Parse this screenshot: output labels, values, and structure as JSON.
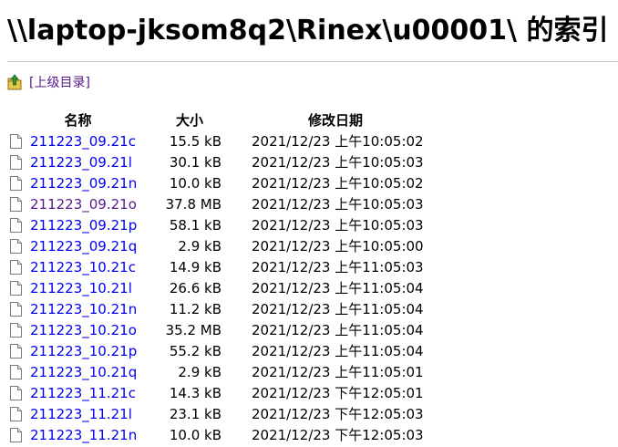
{
  "page": {
    "title": "\\\\laptop-jksom8q2\\Rinex\\u00001\\ 的索引"
  },
  "parent_link": {
    "label": "[上级目录]",
    "icon": "folder-up-icon"
  },
  "columns": {
    "name": "名称",
    "size": "大小",
    "modified": "修改日期"
  },
  "files": [
    {
      "name": "211223_09.21c",
      "size": "15.5 kB",
      "modified": "2021/12/23 上午10:05:02",
      "visited": false
    },
    {
      "name": "211223_09.21l",
      "size": "30.1 kB",
      "modified": "2021/12/23 上午10:05:03",
      "visited": false
    },
    {
      "name": "211223_09.21n",
      "size": "10.0 kB",
      "modified": "2021/12/23 上午10:05:02",
      "visited": false
    },
    {
      "name": "211223_09.21o",
      "size": "37.8 MB",
      "modified": "2021/12/23 上午10:05:03",
      "visited": true
    },
    {
      "name": "211223_09.21p",
      "size": "58.1 kB",
      "modified": "2021/12/23 上午10:05:03",
      "visited": false
    },
    {
      "name": "211223_09.21q",
      "size": "2.9 kB",
      "modified": "2021/12/23 上午10:05:00",
      "visited": false
    },
    {
      "name": "211223_10.21c",
      "size": "14.9 kB",
      "modified": "2021/12/23 上午11:05:03",
      "visited": false
    },
    {
      "name": "211223_10.21l",
      "size": "26.6 kB",
      "modified": "2021/12/23 上午11:05:04",
      "visited": false
    },
    {
      "name": "211223_10.21n",
      "size": "11.2 kB",
      "modified": "2021/12/23 上午11:05:04",
      "visited": false
    },
    {
      "name": "211223_10.21o",
      "size": "35.2 MB",
      "modified": "2021/12/23 上午11:05:04",
      "visited": false
    },
    {
      "name": "211223_10.21p",
      "size": "55.2 kB",
      "modified": "2021/12/23 上午11:05:04",
      "visited": false
    },
    {
      "name": "211223_10.21q",
      "size": "2.9 kB",
      "modified": "2021/12/23 上午11:05:01",
      "visited": false
    },
    {
      "name": "211223_11.21c",
      "size": "14.3 kB",
      "modified": "2021/12/23 下午12:05:01",
      "visited": false
    },
    {
      "name": "211223_11.21l",
      "size": "23.1 kB",
      "modified": "2021/12/23 下午12:05:03",
      "visited": false
    },
    {
      "name": "211223_11.21n",
      "size": "10.0 kB",
      "modified": "2021/12/23 下午12:05:03",
      "visited": false
    }
  ],
  "colors": {
    "link": "#0000ee",
    "visited_link": "#551a8b"
  }
}
